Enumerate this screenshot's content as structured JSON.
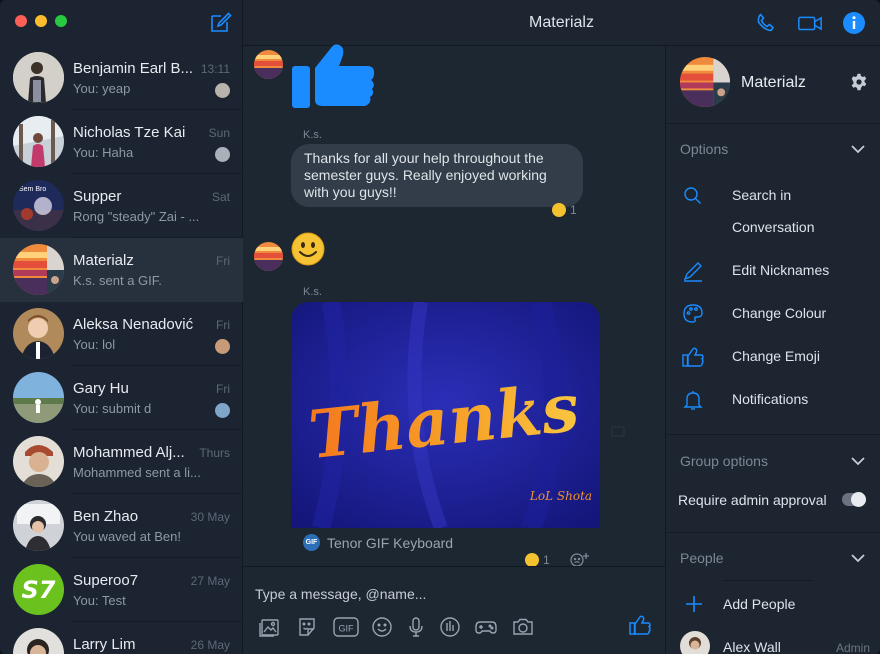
{
  "window": {
    "title": "Materialz"
  },
  "conversations": [
    {
      "name": "Benjamin Earl B...",
      "preview": "You: yeap",
      "time": "13:11"
    },
    {
      "name": "Nicholas Tze Kai",
      "preview": "You: Haha",
      "time": "Sun"
    },
    {
      "name": "Supper",
      "preview": "Rong \"steady\" Zai - ...",
      "time": "Sat",
      "avatar_text": "Sem Bro"
    },
    {
      "name": "Materialz",
      "preview": "K.s. sent a GIF.",
      "time": "Fri"
    },
    {
      "name": "Aleksa Nenadović",
      "preview": "You: lol",
      "time": "Fri"
    },
    {
      "name": "Gary Hu",
      "preview": "You: submit d",
      "time": "Fri"
    },
    {
      "name": "Mohammed Alj...",
      "preview": "Mohammed sent a li...",
      "time": "Thurs"
    },
    {
      "name": "Ben Zhao",
      "preview": "You waved at Ben!",
      "time": "30 May"
    },
    {
      "name": "Superoo7",
      "preview": "You: Test",
      "time": "27 May",
      "avatar_text": "S7"
    },
    {
      "name": "Larry Lim",
      "preview": "",
      "time": "26 May"
    }
  ],
  "chat": {
    "messages": [
      {
        "sender": "K.s.",
        "text": "Thanks for all your help throughout the semester guys. Really enjoyed working with you guys!!",
        "reaction_count": "1"
      },
      {
        "sender": "K.s.",
        "gif_text": "Thanks",
        "gif_signature": "LoL Shota",
        "gif_caption": "Tenor GIF Keyboard",
        "gif_badge": "GIF",
        "reaction_count": "1"
      }
    ]
  },
  "composer": {
    "placeholder": "Type a message, @name..."
  },
  "panel": {
    "name": "Materialz",
    "options_title": "Options",
    "options": [
      {
        "label": "Search in Conversation",
        "icon": "search-icon"
      },
      {
        "label": "Edit Nicknames",
        "icon": "pencil-icon"
      },
      {
        "label": "Change Colour",
        "icon": "palette-icon"
      },
      {
        "label": "Change Emoji",
        "icon": "thumbs-up-icon"
      },
      {
        "label": "Notifications",
        "icon": "bell-icon"
      }
    ],
    "group_options_title": "Group options",
    "require_admin_label": "Require admin approval",
    "require_admin_on": false,
    "people_title": "People",
    "add_people_label": "Add People",
    "people": [
      {
        "name": "Alex Wall",
        "role": "Admin"
      }
    ]
  },
  "colors": {
    "accent": "#1a8cff",
    "bg": "#1d2732"
  }
}
